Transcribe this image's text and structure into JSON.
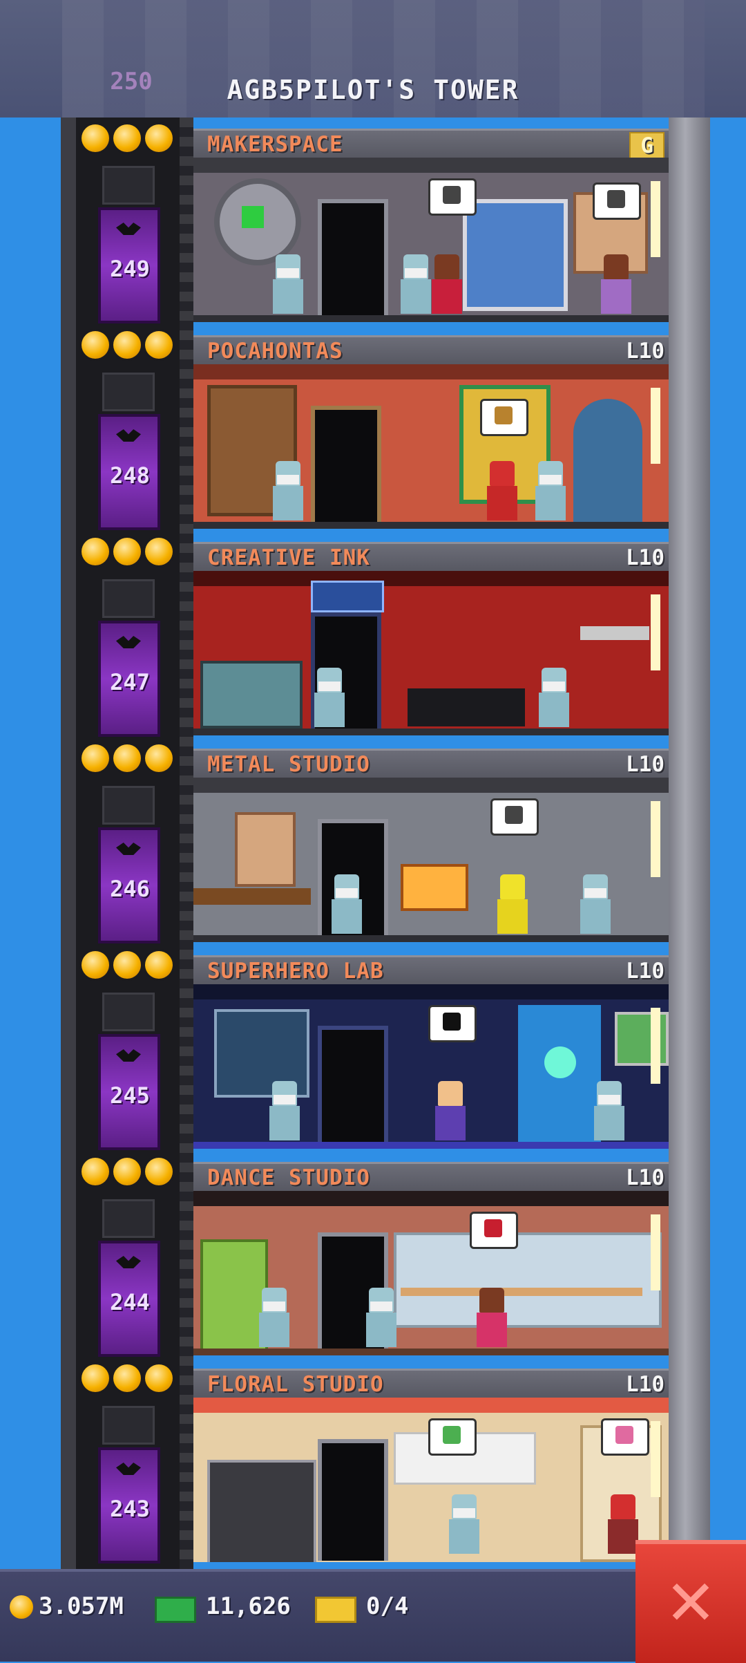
{
  "header": {
    "tower_title": "AGB5PILOT'S TOWER",
    "top_floor_number": "250"
  },
  "floors": [
    {
      "number": "249",
      "name": "MAKERSPACE",
      "level": "G",
      "stars": 3,
      "theme": "#6b6570"
    },
    {
      "number": "248",
      "name": "POCAHONTAS",
      "level": "L10",
      "stars": 3,
      "theme": "#c9573f"
    },
    {
      "number": "247",
      "name": "CREATIVE INK",
      "level": "L10",
      "stars": 3,
      "theme": "#a8231f"
    },
    {
      "number": "246",
      "name": "METAL STUDIO",
      "level": "L10",
      "stars": 3,
      "theme": "#7d8089"
    },
    {
      "number": "245",
      "name": "SUPERHERO LAB",
      "level": "L10",
      "stars": 3,
      "theme": "#1d2450"
    },
    {
      "number": "244",
      "name": "DANCE STUDIO",
      "level": "L10",
      "stars": 3,
      "theme": "#b56a57"
    },
    {
      "number": "243",
      "name": "FLORAL STUDIO",
      "level": "L10",
      "stars": 3,
      "theme": "#e7cfa6"
    }
  ],
  "status": {
    "coins": "3.057M",
    "bux": "11,626",
    "tickets": "0/4"
  },
  "icons": {
    "coin": "coin-icon",
    "bux": "bux-icon",
    "ticket": "ticket-icon",
    "close": "close-icon"
  },
  "colors": {
    "sky": "#2f8fe6",
    "floor_label": "#f28a5a",
    "close_button": "#d9332a"
  }
}
